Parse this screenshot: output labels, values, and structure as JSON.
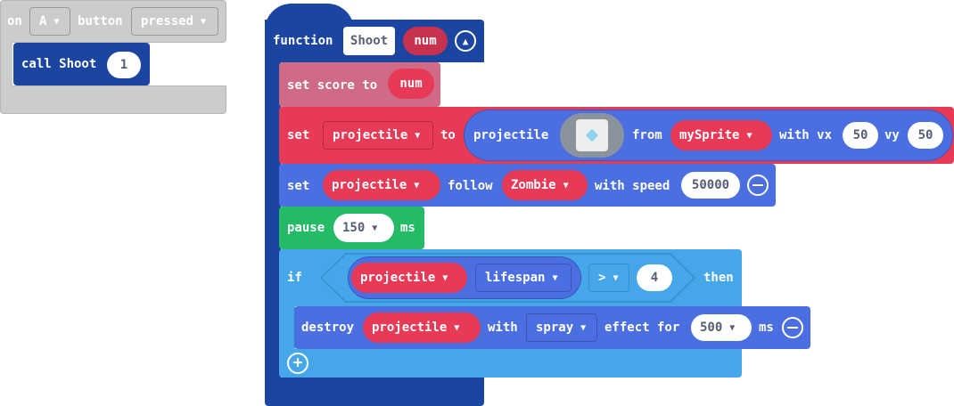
{
  "event_block": {
    "on_label": "on",
    "button_value": "A",
    "button_label": "button",
    "event_value": "pressed",
    "call_label": "call Shoot",
    "call_arg": "1"
  },
  "function_block": {
    "function_label": "function",
    "name": "Shoot",
    "param": "num",
    "set_score": {
      "label": "set score to",
      "value": "num"
    },
    "set_projectile": {
      "set_label": "set",
      "variable": "projectile",
      "to_label": "to",
      "projectile_label": "projectile",
      "from_label": "from",
      "sprite": "mySprite",
      "vx_label": "with vx",
      "vx": "50",
      "vy_label": "vy",
      "vy": "50"
    },
    "follow": {
      "set_label": "set",
      "variable": "projectile",
      "follow_label": "follow",
      "target": "Zombie",
      "speed_label": "with speed",
      "speed": "50000"
    },
    "pause": {
      "label": "pause",
      "value": "150",
      "unit": "ms"
    },
    "if_block": {
      "if_label": "if",
      "variable": "projectile",
      "property": "lifespan",
      "operator": ">",
      "compare_value": "4",
      "then_label": "then",
      "destroy": {
        "label": "destroy",
        "variable": "projectile",
        "with_label": "with",
        "effect": "spray",
        "effect_for_label": "effect for",
        "duration": "500",
        "unit": "ms"
      }
    }
  },
  "colors": {
    "event_gray": "#cccccc",
    "function_blue": "#1b45a0",
    "score_pink": "#cf6a87",
    "sprite_red": "#e63a56",
    "sprite_blue": "#4b6fe0",
    "loops_green": "#23bb66",
    "logic_blue": "#45a7ea"
  }
}
